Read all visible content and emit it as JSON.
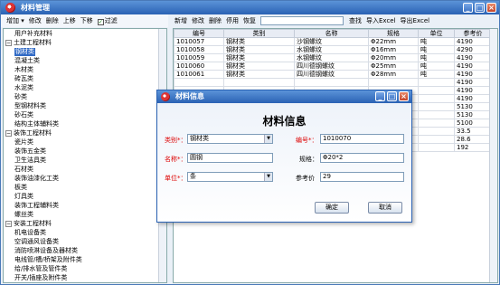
{
  "window": {
    "title": "材料管理"
  },
  "left_toolbar": {
    "add": "增加",
    "edit": "修改",
    "delete": "删除",
    "up": "上移",
    "down": "下移",
    "filter": "过滤"
  },
  "tree": [
    {
      "label": "用户补充材料",
      "level": 1,
      "exp": ""
    },
    {
      "label": "土建工程材料",
      "level": 0,
      "exp": "−"
    },
    {
      "label": "钢材类",
      "level": 1,
      "exp": "",
      "selected": true
    },
    {
      "label": "混凝土类",
      "level": 1,
      "exp": ""
    },
    {
      "label": "木材类",
      "level": 1,
      "exp": ""
    },
    {
      "label": "砖瓦类",
      "level": 1,
      "exp": ""
    },
    {
      "label": "水泥类",
      "level": 1,
      "exp": ""
    },
    {
      "label": "砂类",
      "level": 1,
      "exp": ""
    },
    {
      "label": "型钢材料类",
      "level": 1,
      "exp": ""
    },
    {
      "label": "砂石类",
      "level": 1,
      "exp": ""
    },
    {
      "label": "结构主体辅料类",
      "level": 1,
      "exp": ""
    },
    {
      "label": "装饰工程材料",
      "level": 0,
      "exp": "−"
    },
    {
      "label": "瓷片类",
      "level": 1,
      "exp": ""
    },
    {
      "label": "装饰五金类",
      "level": 1,
      "exp": ""
    },
    {
      "label": "卫生洁具类",
      "level": 1,
      "exp": ""
    },
    {
      "label": "石材类",
      "level": 1,
      "exp": ""
    },
    {
      "label": "装饰油漆化工类",
      "level": 1,
      "exp": ""
    },
    {
      "label": "板类",
      "level": 1,
      "exp": ""
    },
    {
      "label": "灯具类",
      "level": 1,
      "exp": ""
    },
    {
      "label": "装饰工程辅料类",
      "level": 1,
      "exp": ""
    },
    {
      "label": "螺丝类",
      "level": 1,
      "exp": ""
    },
    {
      "label": "安装工程材料",
      "level": 0,
      "exp": "−"
    },
    {
      "label": "机电设备类",
      "level": 1,
      "exp": ""
    },
    {
      "label": "空调通风设备类",
      "level": 1,
      "exp": ""
    },
    {
      "label": "消防喷淋设备及器材类",
      "level": 1,
      "exp": ""
    },
    {
      "label": "电线管/槽/桥架及附件类",
      "level": 1,
      "exp": ""
    },
    {
      "label": "给/排水管及管件类",
      "level": 1,
      "exp": ""
    },
    {
      "label": "开关/插座及附件类",
      "level": 1,
      "exp": ""
    }
  ],
  "right_toolbar": {
    "add": "新增",
    "edit": "修改",
    "delete": "删除",
    "disable": "停用",
    "restore": "恢复",
    "search_value": "",
    "search": "查找",
    "import": "导入Excel",
    "export": "导出Excel"
  },
  "grid": {
    "columns": [
      "编号",
      "类别",
      "名称",
      "规格",
      "单位",
      "参考价"
    ],
    "rows": [
      [
        "1010057",
        "钢材类",
        "沙钢螺纹",
        "Φ22mm",
        "吨",
        "4190"
      ],
      [
        "1010058",
        "钢材类",
        "水钢螺纹",
        "Φ16mm",
        "吨",
        "4290"
      ],
      [
        "1010059",
        "钢材类",
        "水钢螺纹",
        "Φ20mm",
        "吨",
        "4190"
      ],
      [
        "1010060",
        "钢材类",
        "四川德钢螺纹",
        "Φ25mm",
        "吨",
        "4190"
      ],
      [
        "1010061",
        "钢材类",
        "四川德钢螺纹",
        "Φ28mm",
        "吨",
        "4190"
      ],
      [
        "",
        "",
        "",
        "",
        "",
        "4190"
      ],
      [
        "",
        "",
        "",
        "",
        "",
        "4190"
      ],
      [
        "",
        "",
        "",
        "",
        "",
        "4190"
      ],
      [
        "",
        "",
        "",
        "",
        "",
        "5130"
      ],
      [
        "",
        "",
        "",
        "",
        "",
        "5130"
      ],
      [
        "",
        "",
        "",
        "",
        "",
        "5100"
      ],
      [
        "",
        "",
        "",
        "",
        "",
        "33.5"
      ],
      [
        "",
        "",
        "",
        "",
        "",
        "28.6"
      ],
      [
        "",
        "",
        "",
        "",
        "",
        "192"
      ]
    ]
  },
  "dialog": {
    "title": "材料信息",
    "heading": "材料信息",
    "category_label": "类别",
    "category_value": "钢材类",
    "code_label": "编号",
    "code_value": "1010070",
    "name_label": "名称",
    "name_value": "圆钢",
    "spec_label": "规格：",
    "spec_value": "Φ20*2",
    "unit_label": "单位",
    "unit_value": "条",
    "price_label": "参考价",
    "price_value": "29",
    "ok": "确定",
    "cancel": "取消"
  }
}
